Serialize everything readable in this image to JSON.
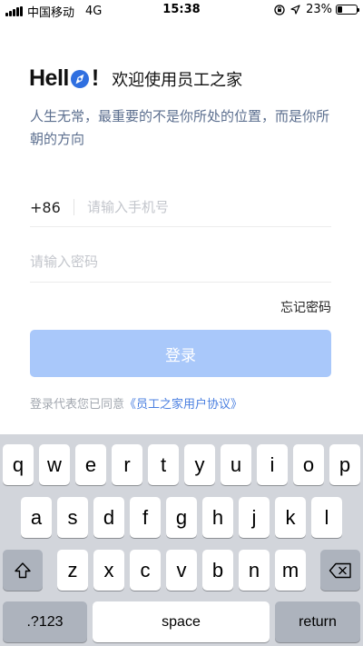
{
  "status_bar": {
    "carrier": "中国移动",
    "network": "4G",
    "time": "15:38",
    "battery_pct": "23%",
    "icons": [
      "signal-icon",
      "orientation-lock-icon",
      "location-icon",
      "battery-icon"
    ]
  },
  "header": {
    "hello_prefix": "Hell",
    "hello_suffix": "!",
    "welcome": "欢迎使用员工之家",
    "subtitle": "人生无常，最重要的不是你所处的位置，而是你所朝的方向"
  },
  "form": {
    "country_code": "+86",
    "phone_placeholder": "请输入手机号",
    "phone_value": "",
    "password_placeholder": "请输入密码",
    "password_value": "",
    "forgot_password": "忘记密码",
    "login_button": "登录",
    "agreement_text": "登录代表您已同意",
    "agreement_link": "《员工之家用户协议》"
  },
  "colors": {
    "accent": "#4a7fe0",
    "button_disabled": "#a9c8fa",
    "subtitle": "#5c6f8f"
  },
  "keyboard": {
    "row1": [
      "q",
      "w",
      "e",
      "r",
      "t",
      "y",
      "u",
      "i",
      "o",
      "p"
    ],
    "row2": [
      "a",
      "s",
      "d",
      "f",
      "g",
      "h",
      "j",
      "k",
      "l"
    ],
    "row3": [
      "z",
      "x",
      "c",
      "v",
      "b",
      "n",
      "m"
    ],
    "shift_icon": "shift-icon",
    "delete_icon": "delete-icon",
    "numbers": ".?123",
    "space": "space",
    "return": "return"
  }
}
